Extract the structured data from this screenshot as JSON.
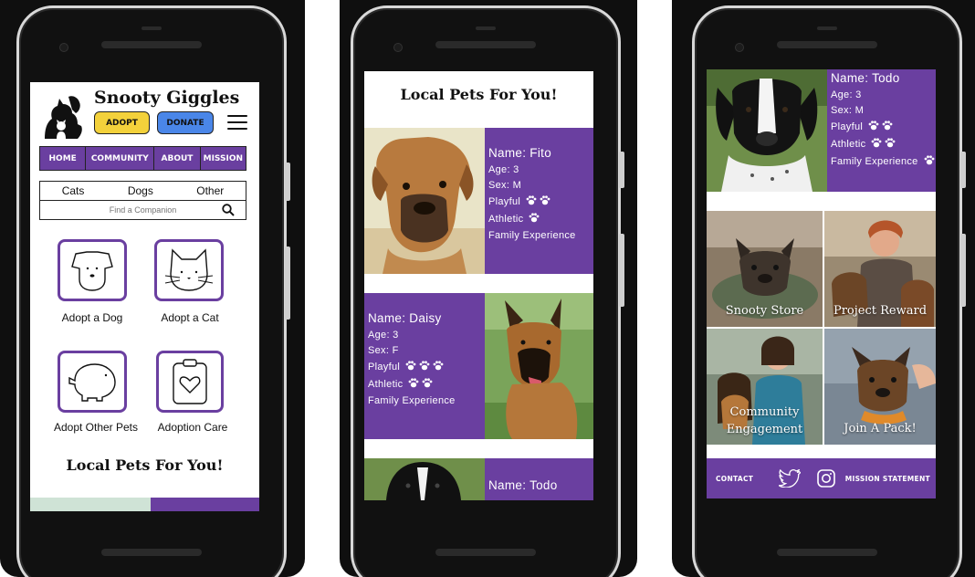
{
  "colors": {
    "purple": "#6a3fa0",
    "adopt_yellow": "#f3d13b",
    "donate_blue": "#4a86e8"
  },
  "phone1": {
    "brand": "Snooty Giggles",
    "adopt_label": "ADOPT",
    "donate_label": "DONATE",
    "nav": [
      "HOME",
      "COMMUNITY",
      "ABOUT",
      "MISSION"
    ],
    "filters": [
      "Cats",
      "Dogs",
      "Other"
    ],
    "search_placeholder": "Find a Companion",
    "tiles": [
      {
        "label": "Adopt a Dog",
        "icon": "dog-face-icon"
      },
      {
        "label": "Adopt a Cat",
        "icon": "cat-face-icon"
      },
      {
        "label": "Adopt Other Pets",
        "icon": "piggy-icon"
      },
      {
        "label": "Adoption Care",
        "icon": "clipboard-heart-icon"
      }
    ],
    "section_title": "Local Pets For You!"
  },
  "phone2": {
    "section_title": "Local Pets For You!",
    "pets": [
      {
        "name": "Name: Fito",
        "age": "Age: 3",
        "sex": "Sex: M",
        "playful": "Playful",
        "playful_paws": 2,
        "athletic": "Athletic",
        "athletic_paws": 1,
        "family": "Family Experience",
        "family_paws": 0
      },
      {
        "name": "Name: Daisy",
        "age": "Age: 3",
        "sex": "Sex: F",
        "playful": "Playful",
        "playful_paws": 3,
        "athletic": "Athletic",
        "athletic_paws": 2,
        "family": "Family Experience",
        "family_paws": 0
      },
      {
        "name": "Name: Todo"
      }
    ]
  },
  "phone3": {
    "pet": {
      "name": "Name: Todo",
      "age": "Age: 3",
      "sex": "Sex: M",
      "playful": "Playful",
      "playful_paws": 2,
      "athletic": "Athletic",
      "athletic_paws": 2,
      "family": "Family Experience",
      "family_paws": 1
    },
    "tiles": [
      "Snooty Store",
      "Project Reward",
      "Community Engagement",
      "Join A Pack!"
    ],
    "footer": {
      "contact": "CONTACT",
      "mission": "MISSION STATEMENT"
    }
  }
}
